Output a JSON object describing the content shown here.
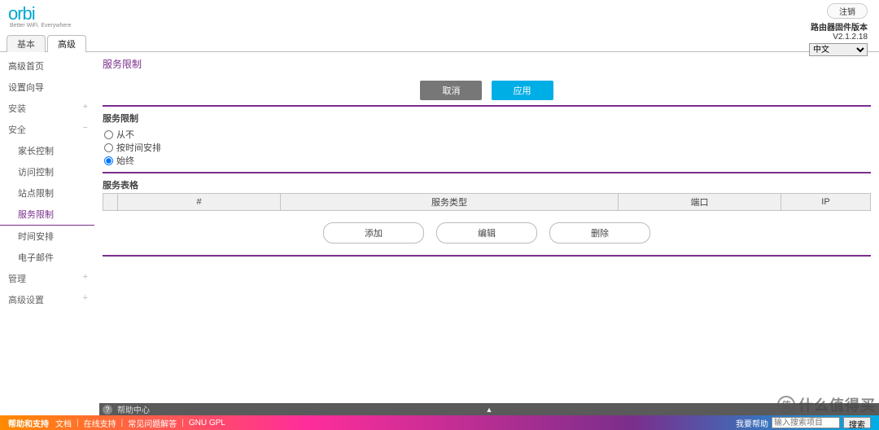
{
  "header": {
    "logo": "orbi",
    "tagline": "Better WiFi. Everywhere",
    "logout": "注销",
    "fw_label": "路由器固件版本",
    "fw_version": "V2.1.2.18",
    "lang_options": [
      "中文"
    ],
    "lang_selected": "中文"
  },
  "tabs": {
    "basic": "基本",
    "advanced": "高级"
  },
  "sidebar": {
    "items": [
      {
        "label": "高级首页",
        "type": "item"
      },
      {
        "label": "设置向导",
        "type": "item"
      },
      {
        "label": "安装",
        "type": "section",
        "plus": "+"
      },
      {
        "label": "安全",
        "type": "section",
        "plus": "−"
      },
      {
        "label": "家长控制",
        "type": "sub"
      },
      {
        "label": "访问控制",
        "type": "sub"
      },
      {
        "label": "站点限制",
        "type": "sub"
      },
      {
        "label": "服务限制",
        "type": "sub",
        "active": true
      },
      {
        "label": "时间安排",
        "type": "sub"
      },
      {
        "label": "电子邮件",
        "type": "sub"
      },
      {
        "label": "管理",
        "type": "section",
        "plus": "+"
      },
      {
        "label": "高级设置",
        "type": "section",
        "plus": "+"
      }
    ]
  },
  "page": {
    "title": "服务限制",
    "cancel": "取消",
    "apply": "应用",
    "section_label": "服务限制",
    "radio_opts": [
      {
        "id": "never",
        "label": "从不"
      },
      {
        "id": "sched",
        "label": "按时间安排"
      },
      {
        "id": "always",
        "label": "始终"
      }
    ],
    "radio_selected": "always",
    "table_label": "服务表格",
    "cols": {
      "chk": "",
      "num": "#",
      "type": "服务类型",
      "port": "端口",
      "ip": "IP"
    },
    "actions": {
      "add": "添加",
      "edit": "编辑",
      "delete": "删除"
    }
  },
  "footer": {
    "help_center": "帮助中心",
    "support_title": "帮助和支持",
    "links": [
      "文档",
      "在线支持",
      "常见问题解答",
      "GNU GPL"
    ],
    "search_label": "我要帮助",
    "search_placeholder": "输入搜索项目",
    "search_btn": "搜索"
  },
  "watermark": {
    "icon": "值",
    "text": "什么值得买"
  }
}
